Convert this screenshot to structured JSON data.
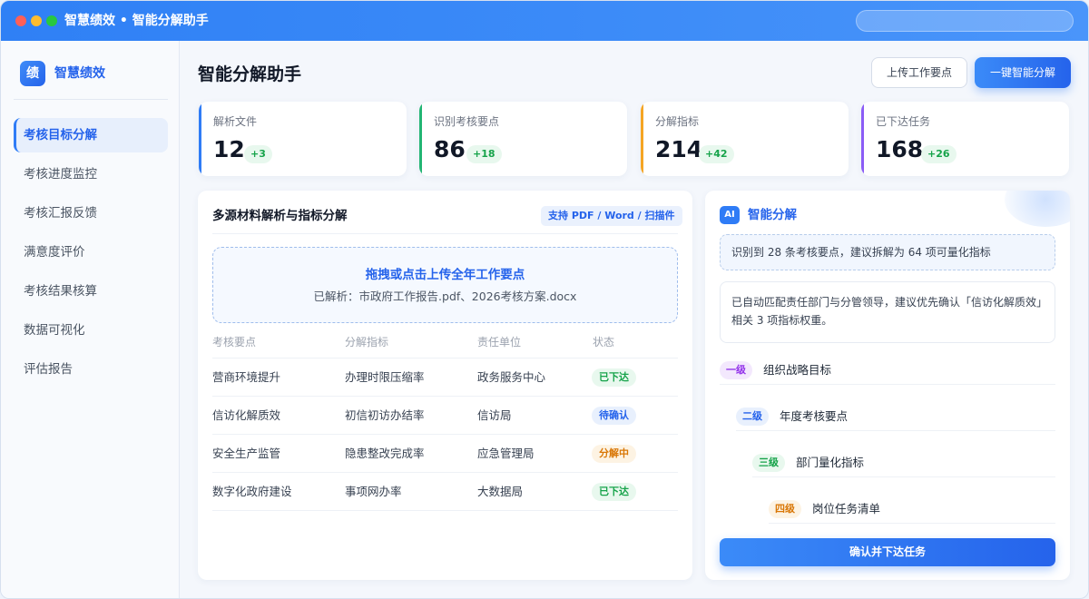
{
  "window": {
    "title": "智慧绩效 • 智能分解助手"
  },
  "sidebar": {
    "logo_char": "绩",
    "logo_text": "智慧绩效",
    "items": [
      {
        "label": "考核目标分解"
      },
      {
        "label": "考核进度监控"
      },
      {
        "label": "考核汇报反馈"
      },
      {
        "label": "满意度评价"
      },
      {
        "label": "考核结果核算"
      },
      {
        "label": "数据可视化"
      },
      {
        "label": "评估报告"
      }
    ]
  },
  "header": {
    "title": "智能分解助手",
    "upload_label": "上传工作要点",
    "primary_label": "一键智能分解"
  },
  "stats": [
    {
      "label": "解析文件",
      "value": "12",
      "delta": "+3",
      "color": "#2f7cf6"
    },
    {
      "label": "识别考核要点",
      "value": "86",
      "delta": "+18",
      "color": "#22b573"
    },
    {
      "label": "分解指标",
      "value": "214",
      "delta": "+42",
      "color": "#f5a524"
    },
    {
      "label": "已下达任务",
      "value": "168",
      "delta": "+26",
      "color": "#8b5cf6"
    }
  ],
  "materials": {
    "title": "多源材料解析与指标分解",
    "badge": "支持 PDF / Word / 扫描件",
    "dropzone_title": "拖拽或点击上传全年工作要点",
    "dropzone_sub": "已解析：市政府工作报告.pdf、2026考核方案.docx",
    "columns": [
      "考核要点",
      "分解指标",
      "责任单位",
      "状态"
    ],
    "rows": [
      {
        "point": "营商环境提升",
        "indicator": "办理时限压缩率",
        "unit": "政务服务中心",
        "status": "已下达",
        "status_color": "#16a34a",
        "status_bg": "#e8f8ee"
      },
      {
        "point": "信访化解质效",
        "indicator": "初信初访办结率",
        "unit": "信访局",
        "status": "待确认",
        "status_color": "#2563eb",
        "status_bg": "#e8f0fd"
      },
      {
        "point": "安全生产监管",
        "indicator": "隐患整改完成率",
        "unit": "应急管理局",
        "status": "分解中",
        "status_color": "#d97706",
        "status_bg": "#fdf3e3"
      },
      {
        "point": "数字化政府建设",
        "indicator": "事项网办率",
        "unit": "大数据局",
        "status": "已下达",
        "status_color": "#16a34a",
        "status_bg": "#e8f8ee"
      }
    ]
  },
  "ai": {
    "icon_label": "AI",
    "title": "智能分解",
    "note": "识别到 28 条考核要点，建议拆解为 64 项可量化指标",
    "message": "已自动匹配责任部门与分管领导，建议优先确认「信访化解质效」相关 3 项指标权重。",
    "levels": [
      {
        "tag": "一级",
        "label": "组织战略目标",
        "color": "#9333ea",
        "bg": "#f3e8fd"
      },
      {
        "tag": "二级",
        "label": "年度考核要点",
        "color": "#2563eb",
        "bg": "#e8f0fd"
      },
      {
        "tag": "三级",
        "label": "部门量化指标",
        "color": "#16a34a",
        "bg": "#e8f8ee"
      },
      {
        "tag": "四级",
        "label": "岗位任务清单",
        "color": "#d97706",
        "bg": "#fdf3e3"
      }
    ],
    "confirm_label": "确认并下达任务"
  }
}
